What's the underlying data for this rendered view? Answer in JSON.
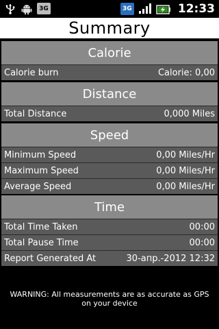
{
  "status_bar": {
    "time": "12:33",
    "icons": [
      "usb-icon",
      "android-icon",
      "3g-box-icon",
      "3g-network-icon",
      "signal-icon",
      "battery-icon"
    ],
    "label_3g_box": "3G",
    "label_3g_net": "3G"
  },
  "title": "Summary",
  "calorie": {
    "heading": "Calorie",
    "rows": [
      {
        "label": "Calorie burn",
        "value": "Calorie: 0,00"
      }
    ]
  },
  "distance": {
    "heading": "Distance",
    "rows": [
      {
        "label": "Total Distance",
        "value": "0,000 Miles"
      }
    ]
  },
  "speed": {
    "heading": "Speed",
    "rows": [
      {
        "label": "Minimum Speed",
        "value": "0,00 Miles/Hr"
      },
      {
        "label": "Maximum Speed",
        "value": "0,00 Miles/Hr"
      },
      {
        "label": "Average Speed",
        "value": "0,00 Miles/Hr"
      }
    ]
  },
  "time": {
    "heading": "Time",
    "rows": [
      {
        "label": "Total Time Taken",
        "value": "00:00"
      },
      {
        "label": "Total Pause Time",
        "value": "00:00"
      },
      {
        "label": "Report Generated At",
        "value": "30-апр.-2012 12:32"
      }
    ]
  },
  "warning": "WARNING: All measurements are as accurate as GPS on your device",
  "colors": {
    "section_header_bg": "#8a8a8a",
    "row_bg": "#5a5a5a",
    "title_bg": "#ffffff",
    "page_bg": "#000000"
  }
}
